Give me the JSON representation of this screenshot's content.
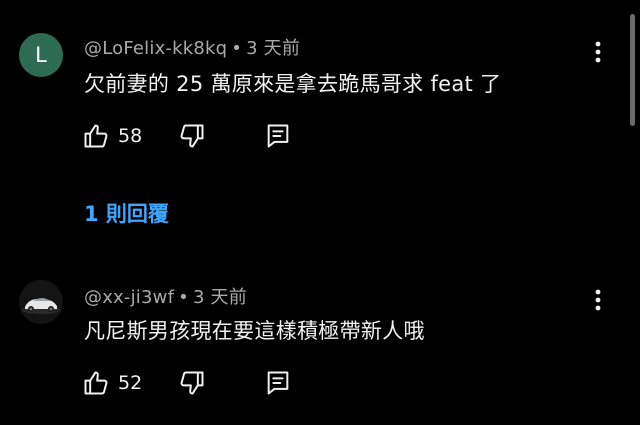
{
  "comments": [
    {
      "avatar_letter": "L",
      "author": "@LoFelix-kk8kq",
      "separator": "•",
      "time": "3 天前",
      "text": "欠前妻的 25 萬原來是拿去跪馬哥求 feat 了",
      "likes": "58",
      "replies_label": "1 則回覆",
      "avatar_color": "#2e6b55"
    },
    {
      "author": "@xx-ji3wf",
      "separator": "•",
      "time": "3 天前",
      "text": "凡尼斯男孩現在要這樣積極帶新人哦",
      "likes": "52"
    }
  ],
  "icons": {
    "like": "thumb-up-icon",
    "dislike": "thumb-down-icon",
    "reply": "comment-icon",
    "more": "more-vert-icon"
  },
  "colors": {
    "background": "#000000",
    "text": "#f1f1f1",
    "meta": "#aaaaaa",
    "link": "#3ea6ff"
  }
}
